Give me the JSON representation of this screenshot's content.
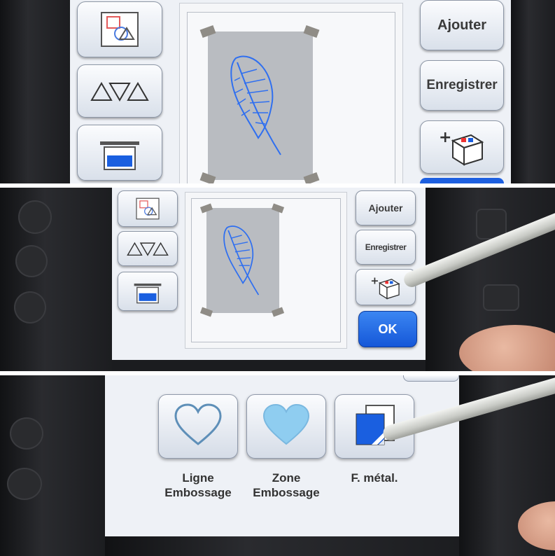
{
  "panel_top": {
    "buttons": {
      "add": "Ajouter",
      "save": "Enregistrer"
    },
    "icons": [
      "shapes-icon",
      "triangles-icon",
      "layout-icon",
      "add-box-icon"
    ]
  },
  "panel_middle": {
    "buttons": {
      "add": "Ajouter",
      "save": "Enregistrer",
      "ok": "OK"
    }
  },
  "panel_bottom": {
    "modes": [
      {
        "line1": "Ligne",
        "line2": "Embossage",
        "icon": "heart-outline-icon"
      },
      {
        "line1": "Zone",
        "line2": "Embossage",
        "icon": "heart-filled-icon"
      },
      {
        "line1": "F. métal.",
        "line2": "",
        "icon": "foil-sheet-icon"
      }
    ]
  },
  "colors": {
    "accent_blue": "#1a5fe0",
    "feather_blue": "#2f6ff0",
    "heart_fill": "#8fcdf0",
    "mat_grey": "#b9bcc1"
  }
}
